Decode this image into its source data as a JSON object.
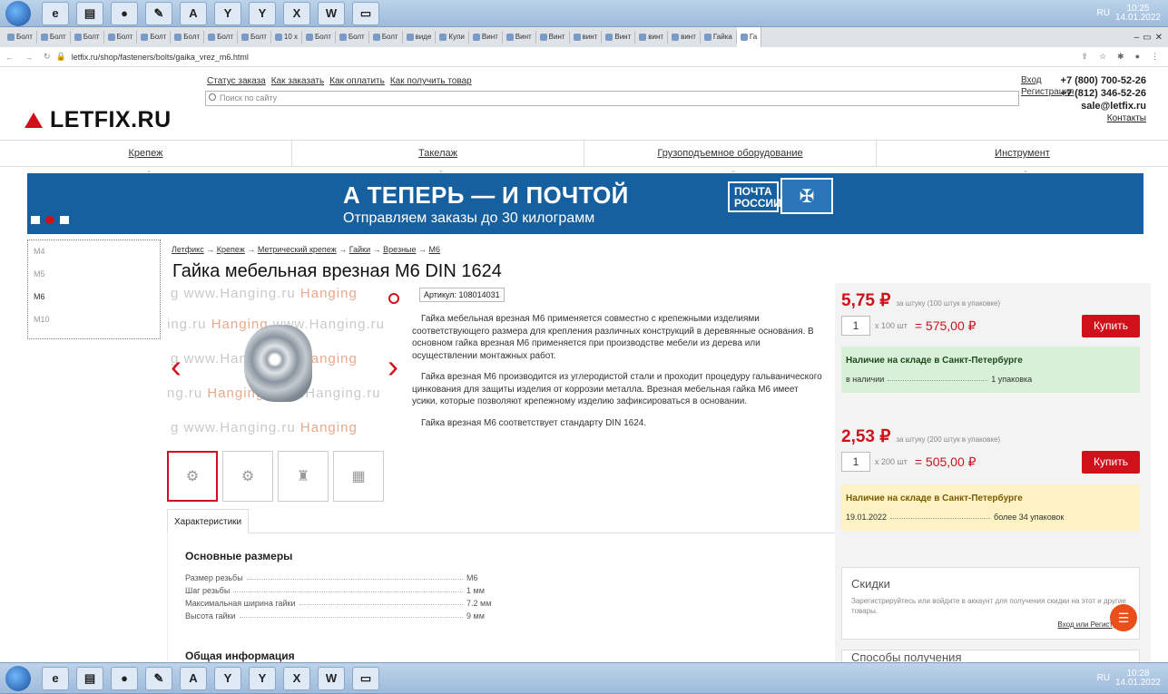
{
  "taskbar": {
    "top_time": "10:25",
    "top_date": "14.01.2022",
    "bottom_time": "10:28",
    "bottom_date": "14.01.2022",
    "lang": "RU",
    "apps": [
      "ie",
      "folder",
      "chrome",
      "paint",
      "pdf",
      "yandex",
      "yandex",
      "excel",
      "word",
      "viewer"
    ],
    "app_glyphs": [
      "e",
      "▤",
      "●",
      "✎",
      "A",
      "Y",
      "Y",
      "X",
      "W",
      "▭"
    ]
  },
  "browser": {
    "tabs": [
      "Болт",
      "Болт",
      "Болт",
      "Болт",
      "Болт",
      "Болт",
      "Болт",
      "Болт",
      "10 x",
      "Болт",
      "Болт",
      "Болт",
      "виде",
      "Купи",
      "Винт",
      "Винт",
      "Винт",
      "винт",
      "Винт",
      "винт",
      "винт",
      "Гайка",
      "Га"
    ],
    "active_tab": "Га",
    "url": "letfix.ru/shop/fasteners/bolts/gaika_vrez_m6.html"
  },
  "header": {
    "logo": "LETFIX.RU",
    "top_links": [
      "Статус заказа",
      "Как заказать",
      "Как оплатить",
      "Как получить товар"
    ],
    "search_placeholder": "Поиск по сайту",
    "login": "Вход",
    "register": "Регистрация",
    "phone1": "+7 (800) 700-52-26",
    "phone2": "+7 (812) 346-52-26",
    "email": "sale@letfix.ru",
    "contacts": "Контакты"
  },
  "nav": [
    "Крепеж",
    "Такелаж",
    "Грузоподъемное оборудование",
    "Инструмент"
  ],
  "banner": {
    "title": "А ТЕПЕРЬ — И ПОЧТОЙ",
    "subtitle": "Отправляем заказы до 30 килограмм",
    "post_logo": "ПОЧТА РОССИИ",
    "colors": {
      "bg": "#17609f",
      "accent": "#d0111c"
    }
  },
  "sidebar": [
    "M4",
    "M5",
    "M6",
    "M10"
  ],
  "breadcrumbs": [
    "Летфикс",
    "Крепеж",
    "Метрический крепеж",
    "Гайки",
    "Врезные",
    "М6"
  ],
  "product": {
    "title": "Гайка мебельная врезная М6 DIN 1624",
    "article": "Артикул: 108014031",
    "watermark": "www.Hanging.ru",
    "watermark_brand": "Hanging",
    "desc": [
      "Гайка мебельная врезная М6 применяется совместно с крепежными изделиями соответствующего размера для крепления различных конструкций в деревянные основания. В основном гайка врезная М6 применяется при производстве мебели из дерева или осуществлении монтажных работ.",
      "Гайка врезная М6 производится из углеродистой стали и проходит процедуру гальванического цинкования для защиты изделия от коррозии металла. Врезная мебельная гайка М6 имеет усики, которые позволяют крепежному изделию зафиксироваться в основании.",
      "Гайка врезная М6 соответствует стандарту DIN 1624."
    ]
  },
  "tabs": {
    "characteristics": "Характеристики"
  },
  "specs": {
    "heading": "Основные размеры",
    "rows": [
      {
        "k": "Размер резьбы",
        "v": "М6"
      },
      {
        "k": "Шаг резьбы",
        "v": "1 мм"
      },
      {
        "k": "Максимальная ширина гайки",
        "v": "7.2 мм"
      },
      {
        "k": "Высота гайки",
        "v": "9 мм"
      }
    ],
    "heading2": "Общая информация"
  },
  "offers": [
    {
      "price": "5,75 ₽",
      "unit": "за штуку (100 штук в упаковке)",
      "qty": "1",
      "mult": "x 100 шт",
      "sum": "= 575,00 ₽",
      "buy": "Купить",
      "stock_title": "Наличие на складе в Санкт-Петербурге",
      "stock_left": "в наличии",
      "stock_right": "1 упаковка"
    },
    {
      "price": "2,53 ₽",
      "unit": "за штуку (200 штук в упаковке)",
      "qty": "1",
      "mult": "x 200 шт",
      "sum": "= 505,00 ₽",
      "buy": "Купить",
      "stock_title": "Наличие на складе в Санкт-Петербурге",
      "stock_left": "19.01.2022",
      "stock_right": "более 34 упаковок"
    }
  ],
  "discounts": {
    "title": "Скидки",
    "text": "Зарегистрируйтесь или войдите в аккаунт для получения скидки на этот и другие товары.",
    "login": "Вход",
    "or": "или",
    "register": "Регистра"
  },
  "delivery": {
    "title": "Способы получения"
  }
}
